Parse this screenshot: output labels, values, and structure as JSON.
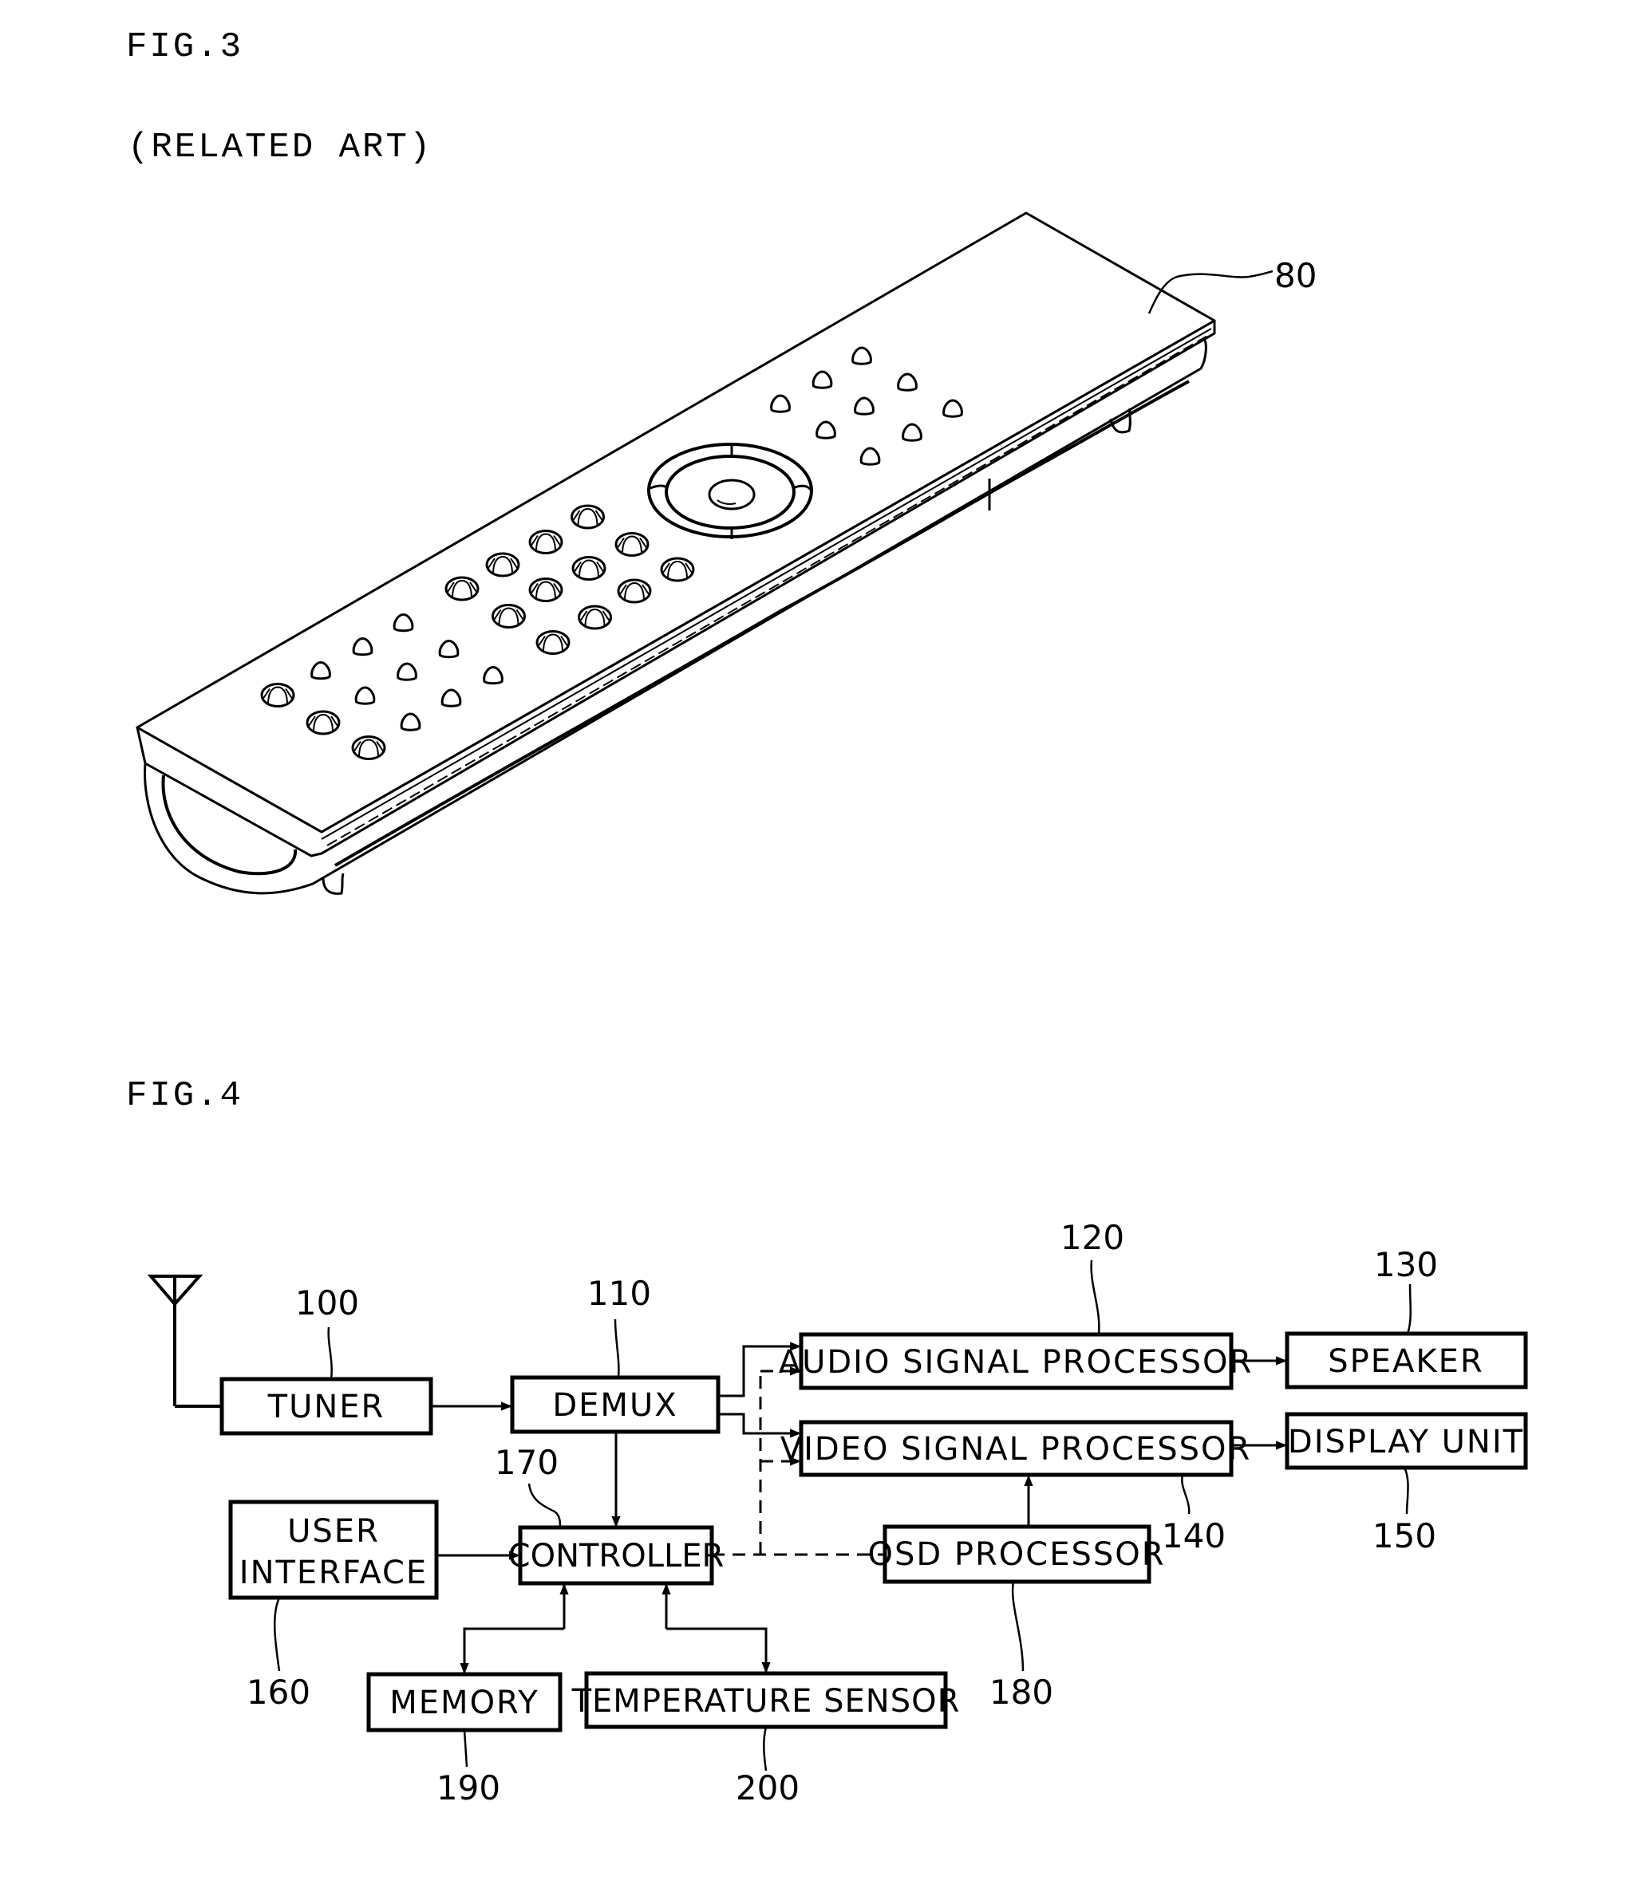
{
  "fig3": {
    "title": "FIG.3",
    "subtitle": "(RELATED ART)",
    "remote_ref": "80",
    "remote_name": "remote controller",
    "icons": {
      "remote": "remote-control-icon",
      "nav_pad": "navigation-ring-icon"
    },
    "button_groups": {
      "numeric_keys": 12,
      "left_large_keys": 3,
      "left_small_keys": 9,
      "right_small_keys": 9
    }
  },
  "fig4": {
    "title": "FIG.4",
    "antenna_icon": "antenna-icon",
    "blocks": {
      "tuner": {
        "label": "TUNER",
        "ref": "100"
      },
      "demux": {
        "label": "DEMUX",
        "ref": "110"
      },
      "audio": {
        "label": "AUDIO SIGNAL PROCESSOR",
        "ref": "120"
      },
      "speaker": {
        "label": "SPEAKER",
        "ref": "130"
      },
      "video": {
        "label": "VIDEO SIGNAL PROCESSOR",
        "ref": "140"
      },
      "display": {
        "label": "DISPLAY UNIT",
        "ref": "150"
      },
      "user_interface": {
        "label_line1": "USER",
        "label_line2": "INTERFACE",
        "ref": "160"
      },
      "controller": {
        "label": "CONTROLLER",
        "ref": "170"
      },
      "osd": {
        "label": "OSD PROCESSOR",
        "ref": "180"
      },
      "memory": {
        "label": "MEMORY",
        "ref": "190"
      },
      "temp": {
        "label": "TEMPERATURE SENSOR",
        "ref": "200"
      }
    },
    "connections": [
      {
        "from": "antenna",
        "to": "tuner",
        "style": "solid"
      },
      {
        "from": "tuner",
        "to": "demux",
        "style": "solid"
      },
      {
        "from": "demux",
        "to": "audio",
        "style": "solid"
      },
      {
        "from": "demux",
        "to": "video",
        "style": "solid"
      },
      {
        "from": "demux",
        "to": "controller",
        "style": "solid"
      },
      {
        "from": "controller",
        "to": "audio",
        "style": "dashed"
      },
      {
        "from": "controller",
        "to": "video",
        "style": "dashed"
      },
      {
        "from": "controller",
        "to": "osd",
        "style": "dashed"
      },
      {
        "from": "audio",
        "to": "speaker",
        "style": "solid"
      },
      {
        "from": "video",
        "to": "display",
        "style": "solid"
      },
      {
        "from": "osd",
        "to": "video",
        "style": "solid"
      },
      {
        "from": "user_interface",
        "to": "controller",
        "style": "solid"
      },
      {
        "from": "controller",
        "to": "memory",
        "style": "bidirectional"
      },
      {
        "from": "controller",
        "to": "temp",
        "style": "bidirectional"
      }
    ]
  }
}
